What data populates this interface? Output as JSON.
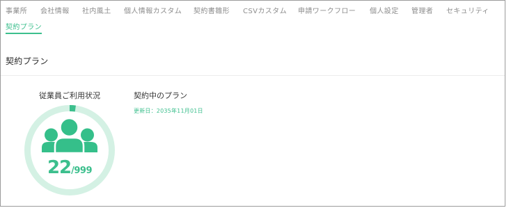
{
  "tabs": [
    {
      "label": "事業所"
    },
    {
      "label": "会社情報"
    },
    {
      "label": "社内風土"
    },
    {
      "label": "個人情報カスタム"
    },
    {
      "label": "契約書雛形"
    },
    {
      "label": "CSVカスタム"
    },
    {
      "label": "申請ワークフロー"
    },
    {
      "label": "個人設定"
    },
    {
      "label": "管理者"
    },
    {
      "label": "セキュリティ"
    },
    {
      "label": "契約プラン",
      "active": true
    }
  ],
  "section": {
    "title": "契約プラン"
  },
  "usage": {
    "title": "従業員ご利用状況",
    "icon": "group-icon",
    "used": 22,
    "separator": "/",
    "total": 999
  },
  "plan": {
    "title": "契約中のプラン",
    "renewal": "更新日：2035年11月01日"
  },
  "colors": {
    "accent": "#3cbf8d",
    "icon": "#35bf8a",
    "ring_track": "#d4f1e4",
    "text": "#333333",
    "tab_text": "#8d8d8d",
    "frame_border": "#9a9a9a",
    "divider": "#ececec"
  }
}
